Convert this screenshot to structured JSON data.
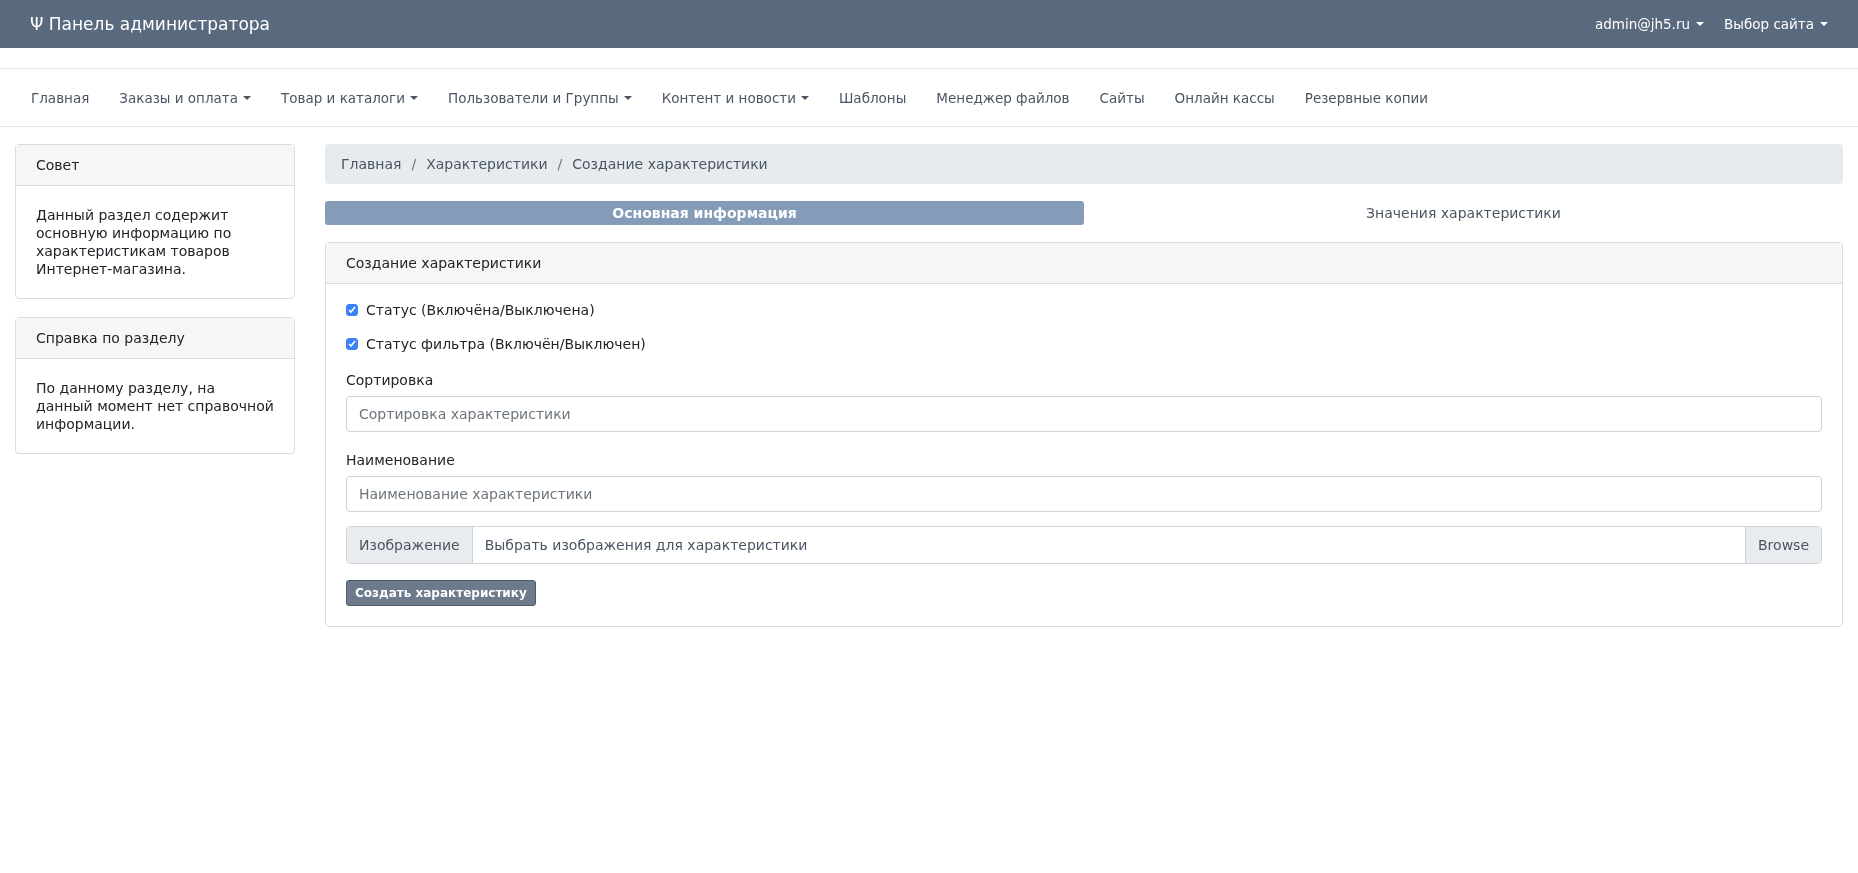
{
  "header": {
    "title": "Ψ Панель администратора",
    "user_menu": "admin@jh5.ru",
    "site_menu": "Выбор сайта"
  },
  "nav": [
    {
      "label": "Главная",
      "dropdown": false
    },
    {
      "label": "Заказы и оплата",
      "dropdown": true
    },
    {
      "label": "Товар и каталоги",
      "dropdown": true
    },
    {
      "label": "Пользователи и Группы",
      "dropdown": true
    },
    {
      "label": "Контент и новости",
      "dropdown": true
    },
    {
      "label": "Шаблоны",
      "dropdown": false
    },
    {
      "label": "Менеджер файлов",
      "dropdown": false
    },
    {
      "label": "Сайты",
      "dropdown": false
    },
    {
      "label": "Онлайн кассы",
      "dropdown": false
    },
    {
      "label": "Резервные копии",
      "dropdown": false
    }
  ],
  "sidebar": [
    {
      "title": "Совет",
      "text": "Данный раздел содержит основную информацию по характеристикам товаров Интернет-магазина."
    },
    {
      "title": "Справка по разделу",
      "text": "По данному разделу, на данный момент нет справочной информации."
    }
  ],
  "breadcrumb": {
    "separator": "/",
    "items": [
      "Главная",
      "Характеристики",
      "Создание характеристики"
    ]
  },
  "tabs": [
    {
      "label": "Основная информация",
      "selected": true
    },
    {
      "label": "Значения характеристики",
      "selected": false
    }
  ],
  "form": {
    "title": "Создание характеристики",
    "checkboxes": [
      {
        "label": "Статус (Включёна/Выключена)",
        "checked": true
      },
      {
        "label": "Статус фильтра (Включён/Выключен)",
        "checked": true
      }
    ],
    "fields": [
      {
        "label": "Сортировка",
        "placeholder": "Сортировка характеристики"
      },
      {
        "label": "Наименование",
        "placeholder": "Наименование характеристики"
      }
    ],
    "file": {
      "prefix": "Изображение",
      "placeholder": "Выбрать изображения для характеристики",
      "button": "Browse"
    },
    "submit": "Создать характеристику"
  }
}
